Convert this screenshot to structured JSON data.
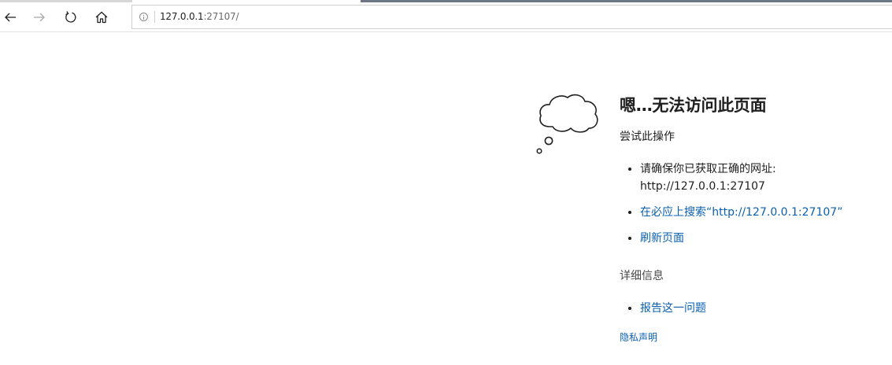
{
  "toolbar": {
    "back_icon": "back-arrow-icon",
    "forward_icon": "forward-arrow-icon",
    "refresh_icon": "refresh-icon",
    "home_icon": "home-icon"
  },
  "address_bar": {
    "info_icon": "info-icon",
    "url_host": "127.0.0.1",
    "url_rest": ":27107/"
  },
  "error_page": {
    "icon": "thought-cloud-icon",
    "title": "嗯…无法访问此页面",
    "subtitle": "尝试此操作",
    "suggestions": [
      {
        "text": "请确保你已获取正确的网址:",
        "text2": "http://127.0.0.1:27107"
      },
      {
        "link": "在必应上搜索“http://127.0.0.1:27107”"
      },
      {
        "link": "刷新页面"
      }
    ],
    "details_heading": "详细信息",
    "details": [
      {
        "link": "报告这一问题"
      }
    ],
    "privacy_link": "隐私声明"
  },
  "colors": {
    "link": "#0a5fb0",
    "text": "#1f1f1f",
    "tab_accent": "#6d7685"
  }
}
